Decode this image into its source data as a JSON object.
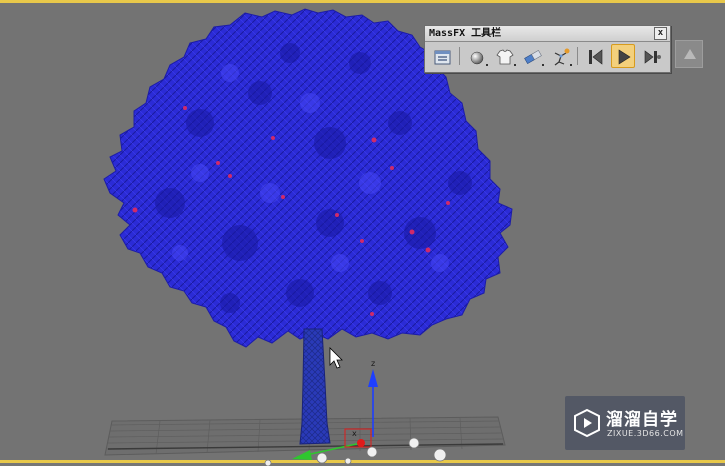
{
  "massfx_toolbar": {
    "title": "MassFX 工具栏",
    "close_label": "x",
    "tools": [
      {
        "name": "world-parameters-icon",
        "active": false
      },
      {
        "name": "rigid-body-icon",
        "active": false
      },
      {
        "name": "mcloth-icon",
        "active": false
      },
      {
        "name": "constraint-icon",
        "active": false
      },
      {
        "name": "ragdoll-icon",
        "active": false
      },
      {
        "name": "reset-simulation-icon",
        "active": false
      },
      {
        "name": "play-simulation-icon",
        "active": true
      },
      {
        "name": "step-simulation-icon",
        "active": false
      }
    ]
  },
  "gizmo": {
    "z_label": "z",
    "x_label": "x"
  },
  "watermark": {
    "name": "溜溜自学",
    "url": "ZIXUE.3D66.COM"
  },
  "colors": {
    "viewport_bg": "#737373",
    "foliage": "#2a2ad8",
    "trunk": "#2636b8",
    "active_border": "#e8c84a",
    "toolbar_active": "#f3d07c",
    "z_axis": "#1e3fff",
    "y_axis": "#2ec62e",
    "x_axis": "#e01b1b"
  }
}
